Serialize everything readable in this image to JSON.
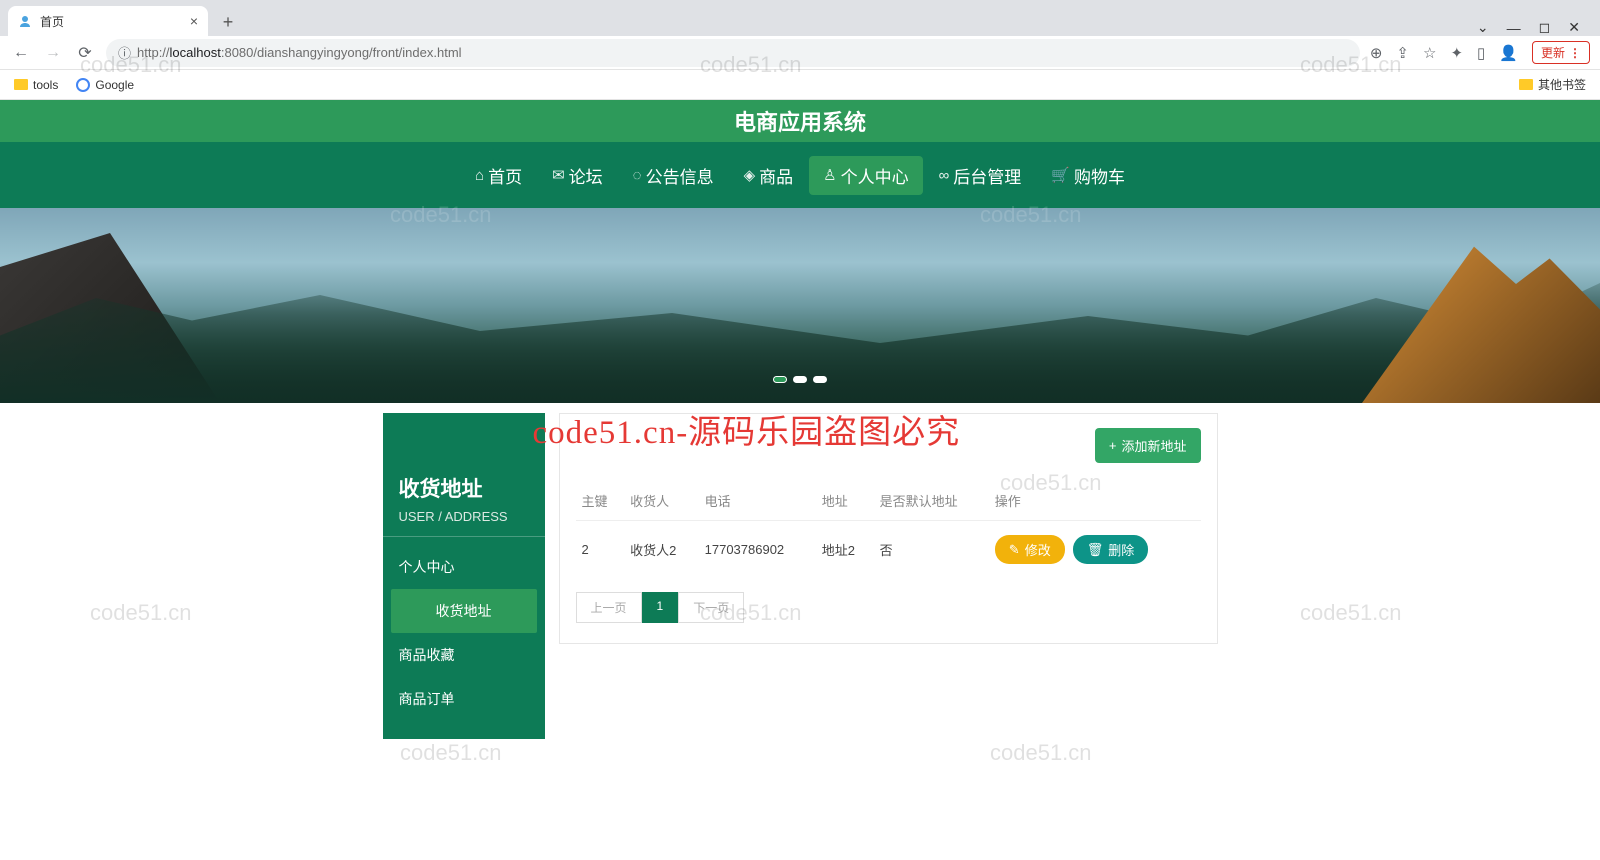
{
  "browser": {
    "tab_title": "首页",
    "url_prefix": "http://",
    "url_host": "localhost",
    "url_port": ":8080",
    "url_path": "/dianshangyingyong/front/index.html",
    "update_label": "更新",
    "bookmarks": {
      "tools": "tools",
      "google": "Google",
      "other": "其他书签"
    }
  },
  "header": {
    "site_title": "电商应用系统",
    "nav": [
      {
        "label": "首页"
      },
      {
        "label": "论坛"
      },
      {
        "label": "公告信息"
      },
      {
        "label": "商品"
      },
      {
        "label": "个人中心"
      },
      {
        "label": "后台管理"
      },
      {
        "label": "购物车"
      }
    ]
  },
  "watermark": {
    "overlay": "code51.cn-源码乐园盗图必究",
    "faint": "code51.cn"
  },
  "sidebar": {
    "title": "收货地址",
    "subtitle": "USER / ADDRESS",
    "items": [
      {
        "label": "个人中心"
      },
      {
        "label": "收货地址"
      },
      {
        "label": "商品收藏"
      },
      {
        "label": "商品订单"
      }
    ]
  },
  "panel": {
    "add_label": "添加新地址",
    "columns": {
      "c0": "主键",
      "c1": "收货人",
      "c2": "电话",
      "c3": "地址",
      "c4": "是否默认地址",
      "c5": "操作"
    },
    "rows": [
      {
        "id": "2",
        "name": "收货人2",
        "phone": "17703786902",
        "addr": "地址2",
        "isdefault": "否"
      }
    ],
    "edit_label": "修改",
    "del_label": "删除",
    "pager": {
      "prev": "上一页",
      "page1": "1",
      "next": "下一页"
    }
  }
}
